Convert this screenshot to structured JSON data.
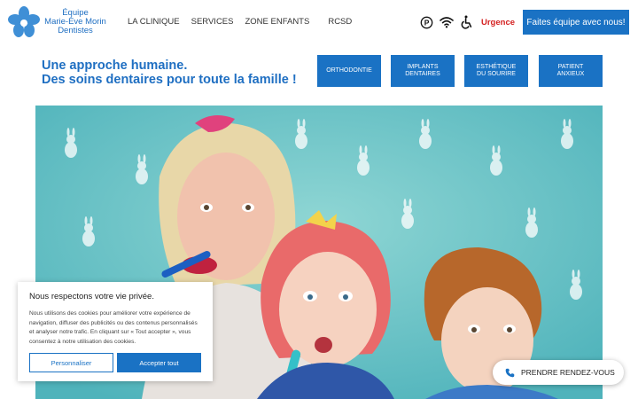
{
  "header": {
    "logo": {
      "line1": "Équipe",
      "line2": "Marie-Ève Morin",
      "line3": "Dentistes"
    },
    "nav": [
      {
        "label": "LA CLINIQUE"
      },
      {
        "label": "SERVICES"
      },
      {
        "label": "ZONE ENFANTS"
      },
      {
        "label": "RCSD"
      }
    ],
    "utility": {
      "parking_icon": "parking-icon",
      "wifi_icon": "wifi-icon",
      "accessibility_icon": "accessibility-icon",
      "urgence_label": "Urgence"
    },
    "cta_label": "Faites équipe avec nous!"
  },
  "intro": {
    "line1": "Une approche humaine.",
    "line2": "Des soins dentaires pour toute la famille !"
  },
  "services": [
    {
      "line1": "ORTHODONTIE",
      "line2": ""
    },
    {
      "line1": "IMPLANTS",
      "line2": "DENTAIRES"
    },
    {
      "line1": "ESTHÉTIQUE",
      "line2": "DU SOURIRE"
    },
    {
      "line1": "PATIENT",
      "line2": "ANXIEUX"
    }
  ],
  "cookie": {
    "title": "Nous respectons votre vie privée.",
    "body": "Nous utilisons des cookies pour améliorer votre expérience de navigation, diffuser des publicités ou des contenus personnalisés et analyser notre trafic. En cliquant sur « Tout accepter », vous consentez à notre utilisation des cookies.",
    "customize_label": "Personnaliser",
    "accept_label": "Accepter tout"
  },
  "booking": {
    "label": "PRENDRE RENDEZ-VOUS",
    "icon": "phone-icon"
  },
  "colors": {
    "brand_blue": "#1a72c4",
    "urgent_red": "#d42020",
    "hero_bg": "#63bfc4"
  }
}
